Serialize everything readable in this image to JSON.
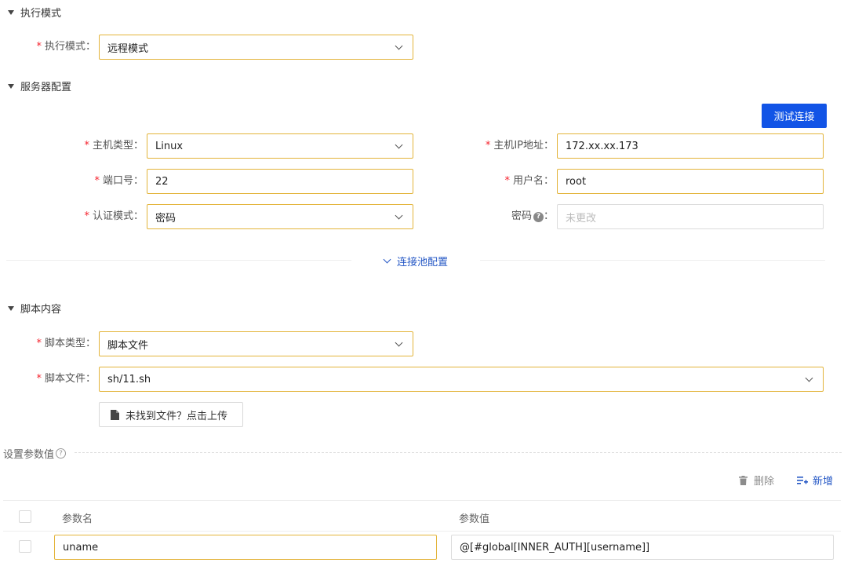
{
  "sections": {
    "exec_mode": "执行模式",
    "server_config": "服务器配置",
    "script_content": "脚本内容"
  },
  "exec": {
    "label": "执行模式：",
    "value": "远程模式"
  },
  "server": {
    "test_button": "测试连接",
    "host_type": {
      "label": "主机类型：",
      "value": "Linux"
    },
    "host_ip": {
      "label": "主机IP地址：",
      "value": "172.xx.xx.173"
    },
    "port": {
      "label": "端口号：",
      "value": "22"
    },
    "username": {
      "label": "用户名：",
      "value": "root"
    },
    "auth_mode": {
      "label": "认证模式：",
      "value": "密码"
    },
    "password": {
      "label": "密码",
      "colon": "：",
      "placeholder": "未更改"
    },
    "pool_link": "连接池配置"
  },
  "script": {
    "type": {
      "label": "脚本类型：",
      "value": "脚本文件"
    },
    "file": {
      "label": "脚本文件：",
      "value": "sh/11.sh"
    },
    "upload_button": "未找到文件？点击上传"
  },
  "params": {
    "title": "设置参数值",
    "delete_label": "删除",
    "add_label": "新增",
    "columns": [
      "参数名",
      "参数值"
    ],
    "rows": [
      {
        "name": "uname",
        "value": "@[#global[INNER_AUTH][username]]"
      }
    ]
  },
  "icons": {
    "help": "?",
    "accent_color": "#1254e6",
    "focus_border": "#e3b43a",
    "required_color": "#f5222d"
  }
}
